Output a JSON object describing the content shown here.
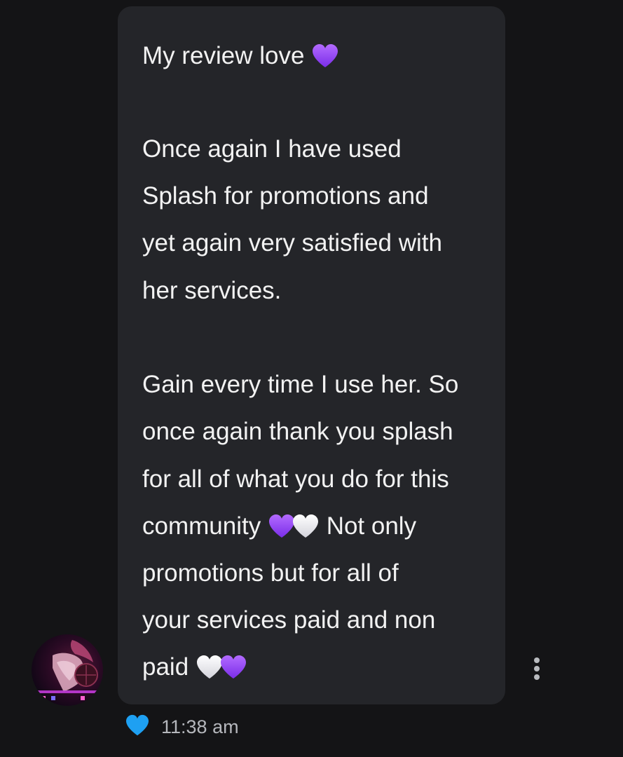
{
  "message": {
    "lines": [
      "My review love",
      "Once again I have used",
      "Splash for promotions and",
      "yet again very satisfied with",
      "her services.",
      "Gain every time I use her. So",
      "once again thank you splash",
      "for all of what you do for this",
      "community",
      "Not only",
      "promotions but for all of",
      "your services paid and non",
      "paid"
    ],
    "timestamp": "11:38 am"
  },
  "icons": {
    "purple_heart": "purple-heart-icon",
    "white_heart": "white-heart-icon",
    "reaction_heart": "blue-heart-icon",
    "more_menu": "more-vertical-icon"
  },
  "colors": {
    "background": "#141416",
    "bubble": "#242529",
    "purple_heart": "#9a4bff",
    "reaction_heart": "#1ea0f2",
    "timestamp": "#b5b7bc"
  }
}
